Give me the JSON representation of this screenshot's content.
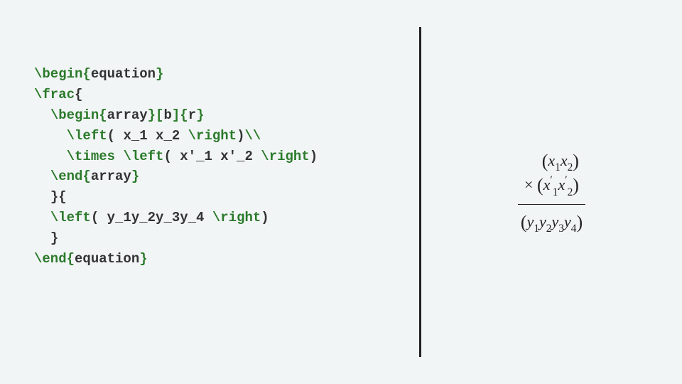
{
  "code": {
    "l1_cmd": "\\begin{",
    "l1_env": "equation",
    "l1_close": "}",
    "l2_cmd": "\\frac",
    "l2_brace": "{",
    "l3_cmd": "\\begin{",
    "l3_env": "array",
    "l3_mid": "}[",
    "l3_opt": "b",
    "l3_mid2": "]{",
    "l3_arg": "r",
    "l3_close": "}",
    "l4_cmd1": "\\left",
    "l4_txt1": "( ",
    "l4_txt2": "x_1 x_2 ",
    "l4_cmd2": "\\right",
    "l4_txt3": ")",
    "l4_cmd3": "\\\\",
    "l5_cmd1": "\\times",
    "l5_sp": " ",
    "l5_cmd2": "\\left",
    "l5_txt1": "( ",
    "l5_txt2": "x'_1 x'_2 ",
    "l5_cmd3": "\\right",
    "l5_txt3": ")",
    "l6_cmd": "\\end{",
    "l6_env": "array",
    "l6_close": "}",
    "l7": "}{",
    "l8_cmd1": "\\left",
    "l8_txt1": "( ",
    "l8_txt2": "y_1y_2y_3y_4 ",
    "l8_cmd2": "\\right",
    "l8_txt3": ")",
    "l9": "}",
    "l10_cmd": "\\end{",
    "l10_env": "equation",
    "l10_close": "}"
  },
  "eq": {
    "lp": "(",
    "rp": ")",
    "times": "×",
    "x": "x",
    "y": "y",
    "prime": "′",
    "s1": "1",
    "s2": "2",
    "s3": "3",
    "s4": "4"
  }
}
